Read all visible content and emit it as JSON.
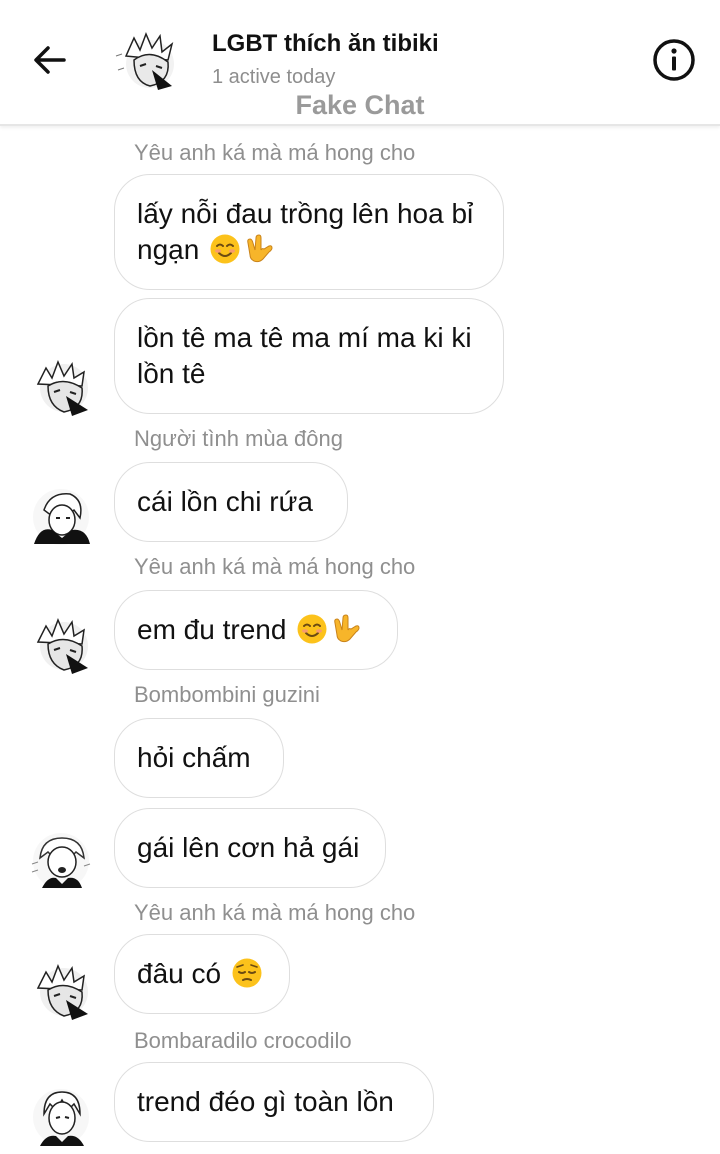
{
  "header": {
    "title": "LGBT thích ăn tibiki",
    "status": "1 active today",
    "watermark": "Fake Chat",
    "icons": [
      "back-arrow-icon",
      "info-icon"
    ]
  },
  "messages": [
    {
      "sender": "Yêu anh ká mà má hong cho",
      "text": "lấy nỗi đau trồng lên hoa bỉ ngạn",
      "emoji": [
        "smiling-blush-emoji",
        "love-you-gesture-emoji"
      ]
    },
    {
      "sender": "",
      "text": "lồn tê ma tê ma mí ma ki ki lồn tê",
      "emoji": []
    },
    {
      "sender": "Người tình mùa đông",
      "text": "cái lồn chi rứa",
      "emoji": []
    },
    {
      "sender": "Yêu anh ká mà má hong cho",
      "text": "em đu trend",
      "emoji": [
        "smiling-blush-emoji",
        "love-you-gesture-emoji"
      ]
    },
    {
      "sender": "Bombombini guzini",
      "text": "hỏi chấm",
      "emoji": []
    },
    {
      "sender": "",
      "text": "gái lên cơn hả gái",
      "emoji": []
    },
    {
      "sender": "Yêu anh ká mà má hong cho",
      "text": "đâu có",
      "emoji": [
        "pensive-emoji"
      ]
    },
    {
      "sender": "Bombaradilo crocodilo",
      "text": "trend đéo gì toàn lồn",
      "emoji": []
    }
  ]
}
